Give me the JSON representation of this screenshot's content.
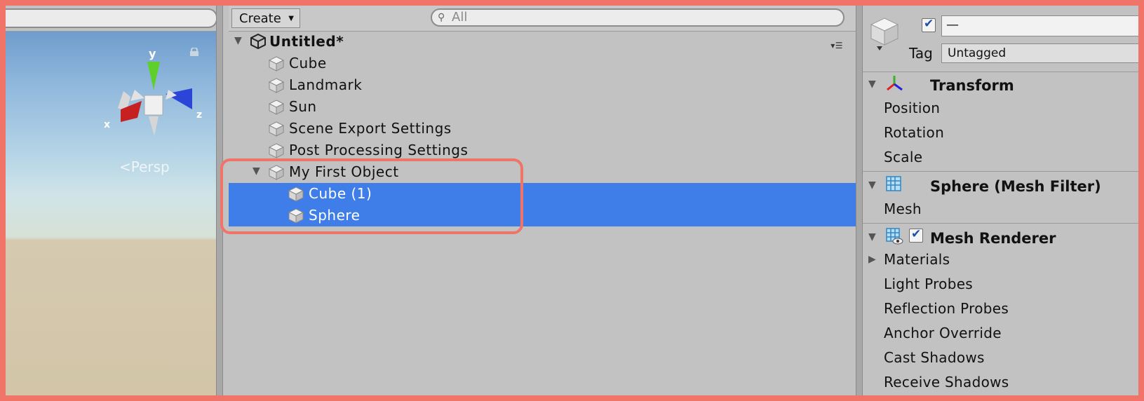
{
  "scene_view": {
    "gizmo": {
      "y_label": "y",
      "x_label": "x",
      "z_label": "z"
    },
    "projection_label": "<Persp"
  },
  "hierarchy": {
    "create_label": "Create",
    "search_placeholder": "All",
    "scene_name": "Untitled*",
    "items": [
      {
        "label": "Cube",
        "depth": 1,
        "selected": false
      },
      {
        "label": "Landmark",
        "depth": 1,
        "selected": false
      },
      {
        "label": "Sun",
        "depth": 1,
        "selected": false
      },
      {
        "label": "Scene Export Settings",
        "depth": 1,
        "selected": false
      },
      {
        "label": "Post Processing Settings",
        "depth": 1,
        "selected": false
      },
      {
        "label": "My First Object",
        "depth": 1,
        "selected": false,
        "expanded": true
      },
      {
        "label": "Cube (1)",
        "depth": 2,
        "selected": true
      },
      {
        "label": "Sphere",
        "depth": 2,
        "selected": true
      }
    ]
  },
  "inspector": {
    "name_value": "—",
    "tag_label": "Tag",
    "tag_value": "Untagged",
    "transform": {
      "title": "Transform",
      "props": [
        "Position",
        "Rotation",
        "Scale"
      ]
    },
    "mesh_filter": {
      "title": "Sphere (Mesh Filter)",
      "props": [
        "Mesh"
      ]
    },
    "mesh_renderer": {
      "title": "Mesh Renderer",
      "materials": "Materials",
      "props": [
        "Light Probes",
        "Reflection Probes",
        "Anchor Override",
        "Cast Shadows",
        "Receive Shadows"
      ]
    }
  },
  "colors": {
    "selection": "#3f7de8",
    "annotation": "#f07468"
  }
}
